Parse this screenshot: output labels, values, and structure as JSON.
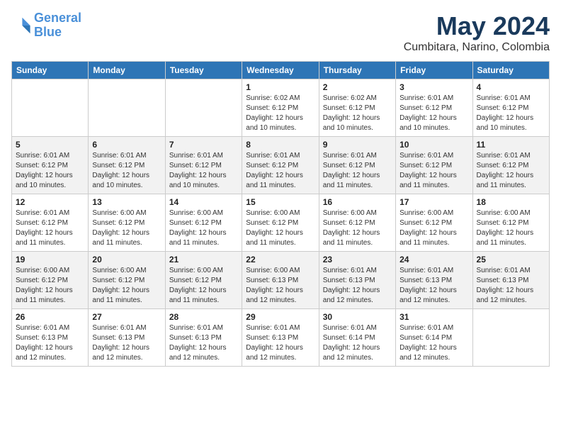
{
  "logo": {
    "line1": "General",
    "line2": "Blue"
  },
  "title": "May 2024",
  "subtitle": "Cumbitara, Narino, Colombia",
  "weekdays": [
    "Sunday",
    "Monday",
    "Tuesday",
    "Wednesday",
    "Thursday",
    "Friday",
    "Saturday"
  ],
  "weeks": [
    [
      null,
      null,
      null,
      {
        "day": "1",
        "sunrise": "6:02 AM",
        "sunset": "6:12 PM",
        "daylight": "12 hours and 10 minutes."
      },
      {
        "day": "2",
        "sunrise": "6:02 AM",
        "sunset": "6:12 PM",
        "daylight": "12 hours and 10 minutes."
      },
      {
        "day": "3",
        "sunrise": "6:01 AM",
        "sunset": "6:12 PM",
        "daylight": "12 hours and 10 minutes."
      },
      {
        "day": "4",
        "sunrise": "6:01 AM",
        "sunset": "6:12 PM",
        "daylight": "12 hours and 10 minutes."
      }
    ],
    [
      {
        "day": "5",
        "sunrise": "6:01 AM",
        "sunset": "6:12 PM",
        "daylight": "12 hours and 10 minutes."
      },
      {
        "day": "6",
        "sunrise": "6:01 AM",
        "sunset": "6:12 PM",
        "daylight": "12 hours and 10 minutes."
      },
      {
        "day": "7",
        "sunrise": "6:01 AM",
        "sunset": "6:12 PM",
        "daylight": "12 hours and 10 minutes."
      },
      {
        "day": "8",
        "sunrise": "6:01 AM",
        "sunset": "6:12 PM",
        "daylight": "12 hours and 11 minutes."
      },
      {
        "day": "9",
        "sunrise": "6:01 AM",
        "sunset": "6:12 PM",
        "daylight": "12 hours and 11 minutes."
      },
      {
        "day": "10",
        "sunrise": "6:01 AM",
        "sunset": "6:12 PM",
        "daylight": "12 hours and 11 minutes."
      },
      {
        "day": "11",
        "sunrise": "6:01 AM",
        "sunset": "6:12 PM",
        "daylight": "12 hours and 11 minutes."
      }
    ],
    [
      {
        "day": "12",
        "sunrise": "6:01 AM",
        "sunset": "6:12 PM",
        "daylight": "12 hours and 11 minutes."
      },
      {
        "day": "13",
        "sunrise": "6:00 AM",
        "sunset": "6:12 PM",
        "daylight": "12 hours and 11 minutes."
      },
      {
        "day": "14",
        "sunrise": "6:00 AM",
        "sunset": "6:12 PM",
        "daylight": "12 hours and 11 minutes."
      },
      {
        "day": "15",
        "sunrise": "6:00 AM",
        "sunset": "6:12 PM",
        "daylight": "12 hours and 11 minutes."
      },
      {
        "day": "16",
        "sunrise": "6:00 AM",
        "sunset": "6:12 PM",
        "daylight": "12 hours and 11 minutes."
      },
      {
        "day": "17",
        "sunrise": "6:00 AM",
        "sunset": "6:12 PM",
        "daylight": "12 hours and 11 minutes."
      },
      {
        "day": "18",
        "sunrise": "6:00 AM",
        "sunset": "6:12 PM",
        "daylight": "12 hours and 11 minutes."
      }
    ],
    [
      {
        "day": "19",
        "sunrise": "6:00 AM",
        "sunset": "6:12 PM",
        "daylight": "12 hours and 11 minutes."
      },
      {
        "day": "20",
        "sunrise": "6:00 AM",
        "sunset": "6:12 PM",
        "daylight": "12 hours and 11 minutes."
      },
      {
        "day": "21",
        "sunrise": "6:00 AM",
        "sunset": "6:12 PM",
        "daylight": "12 hours and 11 minutes."
      },
      {
        "day": "22",
        "sunrise": "6:00 AM",
        "sunset": "6:13 PM",
        "daylight": "12 hours and 12 minutes."
      },
      {
        "day": "23",
        "sunrise": "6:01 AM",
        "sunset": "6:13 PM",
        "daylight": "12 hours and 12 minutes."
      },
      {
        "day": "24",
        "sunrise": "6:01 AM",
        "sunset": "6:13 PM",
        "daylight": "12 hours and 12 minutes."
      },
      {
        "day": "25",
        "sunrise": "6:01 AM",
        "sunset": "6:13 PM",
        "daylight": "12 hours and 12 minutes."
      }
    ],
    [
      {
        "day": "26",
        "sunrise": "6:01 AM",
        "sunset": "6:13 PM",
        "daylight": "12 hours and 12 minutes."
      },
      {
        "day": "27",
        "sunrise": "6:01 AM",
        "sunset": "6:13 PM",
        "daylight": "12 hours and 12 minutes."
      },
      {
        "day": "28",
        "sunrise": "6:01 AM",
        "sunset": "6:13 PM",
        "daylight": "12 hours and 12 minutes."
      },
      {
        "day": "29",
        "sunrise": "6:01 AM",
        "sunset": "6:13 PM",
        "daylight": "12 hours and 12 minutes."
      },
      {
        "day": "30",
        "sunrise": "6:01 AM",
        "sunset": "6:14 PM",
        "daylight": "12 hours and 12 minutes."
      },
      {
        "day": "31",
        "sunrise": "6:01 AM",
        "sunset": "6:14 PM",
        "daylight": "12 hours and 12 minutes."
      },
      null
    ]
  ],
  "labels": {
    "sunrise": "Sunrise:",
    "sunset": "Sunset:",
    "daylight": "Daylight hours"
  }
}
